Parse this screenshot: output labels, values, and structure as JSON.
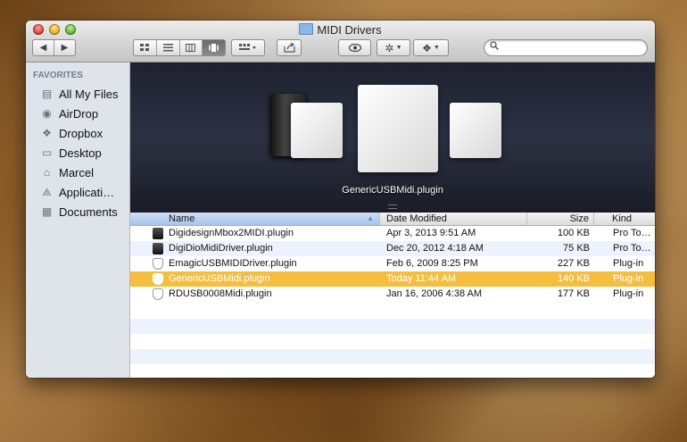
{
  "window": {
    "title": "MIDI Drivers"
  },
  "toolbar": {
    "nav": {
      "back": "◀",
      "forward": "▶"
    },
    "view_buttons": [
      "icon-view",
      "list-view",
      "column-view",
      "coverflow-view"
    ],
    "search": {
      "value": "",
      "placeholder": ""
    }
  },
  "sidebar": {
    "section": "FAVORITES",
    "items": [
      {
        "label": "All My Files",
        "icon": "all-files-icon"
      },
      {
        "label": "AirDrop",
        "icon": "airdrop-icon"
      },
      {
        "label": "Dropbox",
        "icon": "dropbox-icon"
      },
      {
        "label": "Desktop",
        "icon": "desktop-icon"
      },
      {
        "label": "Marcel",
        "icon": "home-icon"
      },
      {
        "label": "Applicati…",
        "icon": "applications-icon"
      },
      {
        "label": "Documents",
        "icon": "documents-icon"
      }
    ]
  },
  "preview": {
    "label": "GenericUSBMidi.plugin"
  },
  "list": {
    "columns": {
      "name": "Name",
      "date": "Date Modified",
      "size": "Size",
      "kind": "Kind"
    },
    "rows": [
      {
        "name": "DigidesignMbox2MIDI.plugin",
        "date": "Apr 3, 2013 9:51 AM",
        "size": "100 KB",
        "kind": "Pro To…",
        "icon": "dark"
      },
      {
        "name": "DigiDioMidiDriver.plugin",
        "date": "Dec 20, 2012 4:18 AM",
        "size": "75 KB",
        "kind": "Pro To…",
        "icon": "dark"
      },
      {
        "name": "EmagicUSBMIDIDriver.plugin",
        "date": "Feb 6, 2009 8:25 PM",
        "size": "227 KB",
        "kind": "Plug-in",
        "icon": "shield"
      },
      {
        "name": "GenericUSBMidi.plugin",
        "date": "Today 11:44 AM",
        "size": "140 KB",
        "kind": "Plug-in",
        "icon": "shield",
        "selected": true
      },
      {
        "name": "RDUSB0008Midi.plugin",
        "date": "Jan 16, 2006 4:38 AM",
        "size": "177 KB",
        "kind": "Plug-in",
        "icon": "shield"
      }
    ]
  },
  "colors": {
    "selection": "#f6be3e",
    "sidebar_bg": "#dee4ea",
    "stripe": "#edf3fe"
  }
}
